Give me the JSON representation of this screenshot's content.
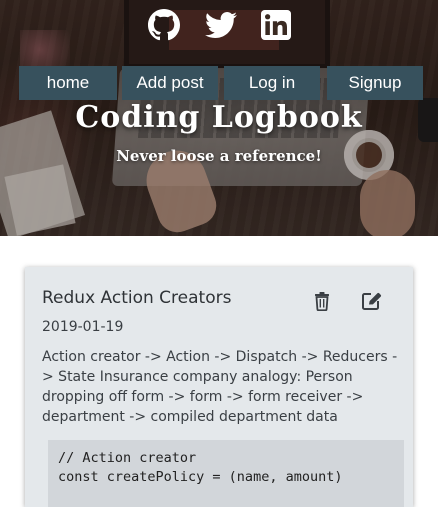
{
  "header": {
    "social": [
      {
        "icon": "github-icon",
        "label": "GitHub"
      },
      {
        "icon": "twitter-icon",
        "label": "Twitter"
      },
      {
        "icon": "linkedin-icon",
        "label": "LinkedIn"
      }
    ],
    "nav": [
      {
        "label": "home"
      },
      {
        "label": "Add post"
      },
      {
        "label": "Log in"
      },
      {
        "label": "Signup"
      }
    ],
    "title": "Coding Logbook",
    "subtitle": "Never loose a reference!"
  },
  "post": {
    "title": "Redux Action Creators",
    "date": "2019-01-19",
    "body": "Action creator -> Action -> Dispatch -> Reducers -> State Insurance company analogy: Person dropping off form -> form -> form receiver -> department -> compiled department data",
    "actions": {
      "delete_icon": "trash-icon",
      "edit_icon": "edit-icon"
    },
    "code_lines": [
      "// Action creator",
      "const createPolicy = (name, amount)"
    ]
  },
  "colors": {
    "nav_bg": "#37515d",
    "card_bg": "#e4e8eb",
    "code_bg": "#d2d6da"
  }
}
